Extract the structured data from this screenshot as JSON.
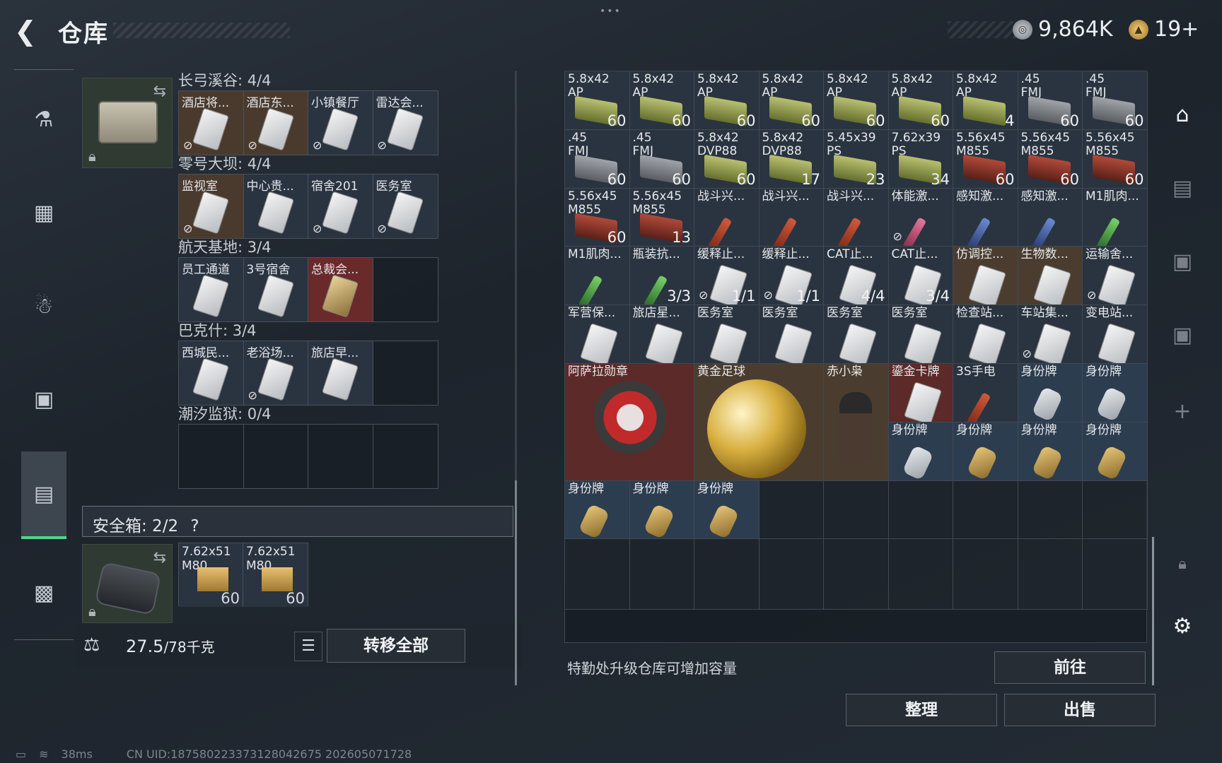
{
  "header": {
    "title": "仓库",
    "currency1": "9,864K",
    "currency2": "19+"
  },
  "left_sections": [
    {
      "title": "长弓溪谷: 4/4",
      "slots": [
        {
          "label": "酒店将...",
          "bg": "brown",
          "lock": true
        },
        {
          "label": "酒店东...",
          "bg": "brown",
          "lock": true
        },
        {
          "label": "小镇餐厅",
          "bg": "dark",
          "lock": true
        },
        {
          "label": "雷达会...",
          "bg": "dark",
          "lock": true
        }
      ]
    },
    {
      "title": "零号大坝: 4/4",
      "slots": [
        {
          "label": "监视室",
          "bg": "brown",
          "lock": true
        },
        {
          "label": "中心贵...",
          "bg": "dark",
          "lock": false
        },
        {
          "label": "宿舍201",
          "bg": "dark",
          "lock": true
        },
        {
          "label": "医务室",
          "bg": "dark",
          "lock": true
        }
      ]
    },
    {
      "title": "航天基地: 3/4",
      "slots": [
        {
          "label": "员工通道",
          "bg": "dark",
          "lock": false
        },
        {
          "label": "3号宿舍",
          "bg": "dark",
          "lock": false
        },
        {
          "label": "总裁会...",
          "bg": "red",
          "lock": false,
          "gold": true
        },
        {
          "label": "",
          "bg": "empty",
          "lock": false
        }
      ]
    },
    {
      "title": "巴克什: 3/4",
      "slots": [
        {
          "label": "西城民...",
          "bg": "dark",
          "lock": false
        },
        {
          "label": "老浴场...",
          "bg": "dark",
          "lock": true
        },
        {
          "label": "旅店早...",
          "bg": "dark",
          "lock": false
        },
        {
          "label": "",
          "bg": "empty",
          "lock": false
        }
      ]
    },
    {
      "title": "潮汐监狱: 0/4",
      "slots": [
        {
          "label": "",
          "bg": "empty",
          "lock": false
        },
        {
          "label": "",
          "bg": "empty",
          "lock": false
        },
        {
          "label": "",
          "bg": "empty",
          "lock": false
        },
        {
          "label": "",
          "bg": "empty",
          "lock": false
        }
      ]
    }
  ],
  "safebox": {
    "label": "安全箱:  2/2",
    "help": "?",
    "items": [
      {
        "name": "7.62x51\nM80",
        "qty": "60"
      },
      {
        "name": "7.62x51\nM80",
        "qty": "60"
      }
    ]
  },
  "weight": {
    "value": "27.5",
    "max": "/78千克"
  },
  "buttons": {
    "transfer_all": "转移全部",
    "goto": "前往",
    "sort": "整理",
    "sell": "出售"
  },
  "note": "特勤处升级仓库可增加容量",
  "grid_rows": [
    [
      {
        "n": "5.8x42\nAP",
        "q": "60",
        "t": "ammo"
      },
      {
        "n": "5.8x42\nAP",
        "q": "60",
        "t": "ammo"
      },
      {
        "n": "5.8x42\nAP",
        "q": "60",
        "t": "ammo"
      },
      {
        "n": "5.8x42\nAP",
        "q": "60",
        "t": "ammo"
      },
      {
        "n": "5.8x42\nAP",
        "q": "60",
        "t": "ammo"
      },
      {
        "n": "5.8x42\nAP",
        "q": "60",
        "t": "ammo"
      },
      {
        "n": "5.8x42\nAP",
        "q": "4",
        "t": "ammo"
      },
      {
        "n": ".45\nFMJ",
        "q": "60",
        "t": "ammo-grey"
      },
      {
        "n": ".45\nFMJ",
        "q": "60",
        "t": "ammo-grey"
      }
    ],
    [
      {
        "n": ".45\nFMJ",
        "q": "60",
        "t": "ammo-grey"
      },
      {
        "n": ".45\nFMJ",
        "q": "60",
        "t": "ammo-grey"
      },
      {
        "n": "5.8x42\nDVP88",
        "q": "60",
        "t": "ammo"
      },
      {
        "n": "5.8x42\nDVP88",
        "q": "17",
        "t": "ammo"
      },
      {
        "n": "5.45x39\nPS",
        "q": "23",
        "t": "ammo"
      },
      {
        "n": "7.62x39\nPS",
        "q": "34",
        "t": "ammo"
      },
      {
        "n": "5.56x45\nM855",
        "q": "60",
        "t": "ammo-red"
      },
      {
        "n": "5.56x45\nM855",
        "q": "60",
        "t": "ammo-red"
      },
      {
        "n": "5.56x45\nM855",
        "q": "60",
        "t": "ammo-red"
      }
    ],
    [
      {
        "n": "5.56x45\nM855",
        "q": "60",
        "t": "ammo-red"
      },
      {
        "n": "5.56x45\nM855",
        "q": "13",
        "t": "ammo-red"
      },
      {
        "n": "战斗兴...",
        "q": "",
        "t": "syr"
      },
      {
        "n": "战斗兴...",
        "q": "",
        "t": "syr"
      },
      {
        "n": "战斗兴...",
        "q": "",
        "t": "syr"
      },
      {
        "n": "体能激...",
        "q": "",
        "t": "syr-pink",
        "lock": true
      },
      {
        "n": "感知激...",
        "q": "",
        "t": "syr-blue"
      },
      {
        "n": "感知激...",
        "q": "",
        "t": "syr-blue"
      },
      {
        "n": "M1肌肉...",
        "q": "",
        "t": "syr-green"
      }
    ],
    [
      {
        "n": "M1肌肉...",
        "q": "",
        "t": "syr-green"
      },
      {
        "n": "瓶装抗...",
        "q": "3/3",
        "t": "syr-green"
      },
      {
        "n": "缓释止...",
        "q": "1/1",
        "t": "card",
        "lock": true
      },
      {
        "n": "缓释止...",
        "q": "1/1",
        "t": "card",
        "lock": true
      },
      {
        "n": "CAT止...",
        "q": "4/4",
        "t": "card"
      },
      {
        "n": "CAT止...",
        "q": "3/4",
        "t": "card"
      },
      {
        "n": "仿调控...",
        "q": "",
        "t": "card",
        "bg": "brown"
      },
      {
        "n": "生物数...",
        "q": "",
        "t": "card",
        "bg": "brown"
      },
      {
        "n": "运输舍...",
        "q": "",
        "t": "card",
        "lock": true
      }
    ],
    [
      {
        "n": "军营保...",
        "q": "",
        "t": "card"
      },
      {
        "n": "旅店星...",
        "q": "",
        "t": "card"
      },
      {
        "n": "医务室",
        "q": "",
        "t": "card"
      },
      {
        "n": "医务室",
        "q": "",
        "t": "card"
      },
      {
        "n": "医务室",
        "q": "",
        "t": "card"
      },
      {
        "n": "医务室",
        "q": "",
        "t": "card"
      },
      {
        "n": "检查站...",
        "q": "",
        "t": "card"
      },
      {
        "n": "车站集...",
        "q": "",
        "t": "card",
        "lock": true
      },
      {
        "n": "变电站...",
        "q": "",
        "t": "card"
      }
    ]
  ],
  "big_items": {
    "medal": "阿萨拉勋章",
    "ball": "黄金足球",
    "owl": "赤小枭",
    "card": "鎏金卡牌",
    "phone": "3S手电"
  },
  "dogtags_row1": [
    "身份牌",
    "身份牌"
  ],
  "dogtags_row2": [
    "身份牌",
    "身份牌",
    "身份牌",
    "身份牌"
  ],
  "dogtags_row3": [
    "身份牌",
    "身份牌",
    "身份牌"
  ],
  "status": {
    "ping": "38ms",
    "uid": "CN UID:187580223373128042675 202605071728"
  }
}
